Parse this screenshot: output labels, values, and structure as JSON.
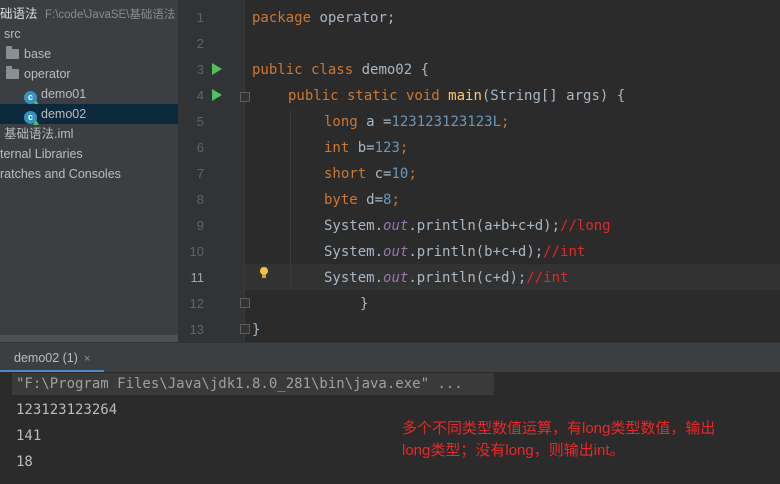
{
  "project_tree": {
    "root_name": "础语法",
    "root_path": "F:\\code\\JavaSE\\基础语法",
    "items": [
      {
        "label": "src"
      },
      {
        "label": "base"
      },
      {
        "label": "operator"
      },
      {
        "label": "demo01"
      },
      {
        "label": "demo02"
      },
      {
        "label": "基础语法.iml"
      },
      {
        "label": "ternal Libraries"
      },
      {
        "label": "ratches and Consoles"
      }
    ]
  },
  "editor": {
    "line_numbers": [
      "1",
      "2",
      "3",
      "4",
      "5",
      "6",
      "7",
      "8",
      "9",
      "10",
      "11",
      "12",
      "13"
    ],
    "current_line": 11,
    "code": {
      "l1_kw": "package",
      "l1_rest": " operator;",
      "l3_kw": "public class",
      "l3_rest": " demo02 {",
      "l4_kw": "public static void",
      "l4_fn": "main",
      "l4_rest": "(String[] args) {",
      "l5_kw": "long",
      "l5_a": " a =",
      "l5_num": "123123123123L",
      "l5_end": ";",
      "l6_kw": "int",
      "l6_a": " b=",
      "l6_num": "123",
      "l6_end": ";",
      "l7_kw": "short",
      "l7_a": " c=",
      "l7_num": "10",
      "l7_end": ";",
      "l8_kw": "byte",
      "l8_a": " d=",
      "l8_num": "8",
      "l8_end": ";",
      "sys": "System.",
      "out": "out",
      "l9_rest": ".println(a+b+c+d);",
      "l9_cmt": "//long",
      "l10_rest": ".println(b+c+d);",
      "l10_cmt": "//int",
      "l11_rest": ".println(c+d);",
      "l11_cmt": "//int",
      "l12": "}",
      "l13": "}"
    }
  },
  "run_panel": {
    "tab_label": "demo02 (1)",
    "close_glyph": "×",
    "command": "\"F:\\Program Files\\Java\\jdk1.8.0_281\\bin\\java.exe\" ...",
    "outputs": [
      "123123123264",
      "141",
      "18"
    ],
    "note": "多个不同类型数值运算，有long类型数值，输出long类型；没有long，则输出int。"
  },
  "colors": {
    "keyword": "#cc7832",
    "number": "#6897bb",
    "comment": "#e0282a",
    "run_icon": "#4fbf5f",
    "selection": "#0d293e"
  }
}
